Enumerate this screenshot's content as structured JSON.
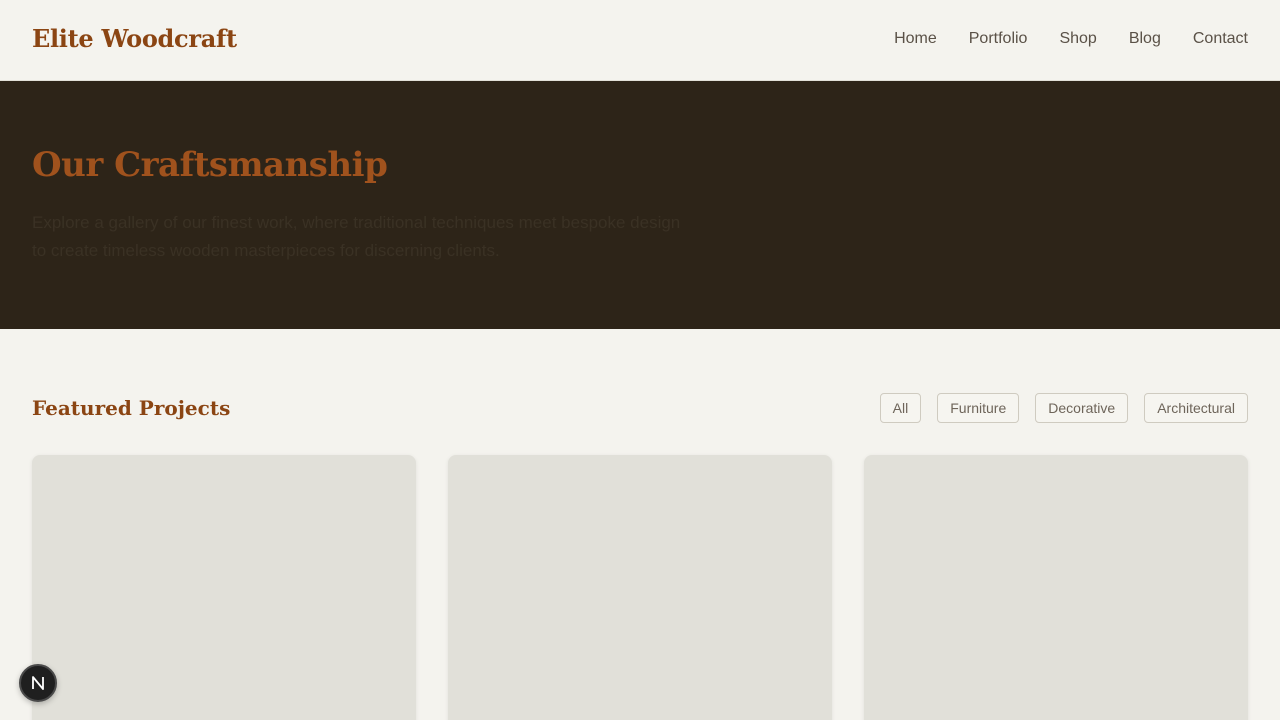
{
  "header": {
    "logo": "Elite Woodcraft",
    "nav": [
      {
        "label": "Home"
      },
      {
        "label": "Portfolio"
      },
      {
        "label": "Shop"
      },
      {
        "label": "Blog"
      },
      {
        "label": "Contact"
      }
    ]
  },
  "hero": {
    "title": "Our Craftsmanship",
    "text": "Explore a gallery of our finest work, where traditional techniques meet bespoke design to create timeless wooden masterpieces for discerning clients."
  },
  "featured": {
    "title": "Featured Projects",
    "filters": [
      {
        "label": "All"
      },
      {
        "label": "Furniture"
      },
      {
        "label": "Decorative"
      },
      {
        "label": "Architectural"
      }
    ]
  },
  "badge": {
    "icon": "n-logo-icon"
  },
  "colors": {
    "brand": "#8b4513",
    "hero_bg": "#2d2418",
    "page_bg": "#f4f3ee",
    "card_bg": "#e1e0d9"
  }
}
